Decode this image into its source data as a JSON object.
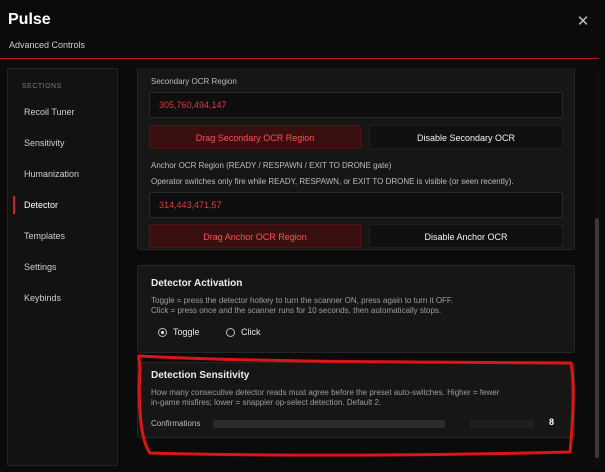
{
  "app": {
    "title": "Pulse",
    "subtitle": "Advanced Controls",
    "close_icon": "close-icon",
    "accent_color": "#c2161f"
  },
  "sidebar": {
    "section_label": "SECTIONS",
    "items": [
      {
        "label": "Recoil Tuner",
        "active": false
      },
      {
        "label": "Sensitivity",
        "active": false
      },
      {
        "label": "Humanization",
        "active": false
      },
      {
        "label": "Detector",
        "active": true
      },
      {
        "label": "Templates",
        "active": false
      },
      {
        "label": "Settings",
        "active": false
      },
      {
        "label": "Keybinds",
        "active": false
      }
    ]
  },
  "secondary_ocr": {
    "label": "Secondary OCR Region",
    "value": "305,760,494,147",
    "drag_label": "Drag Secondary OCR Region",
    "disable_label": "Disable Secondary OCR"
  },
  "anchor_ocr": {
    "label": "Anchor OCR Region (READY / RESPAWN / EXIT TO DRONE gate)",
    "description": "Operator switches only fire while READY, RESPAWN, or EXIT TO DRONE is visible (or seen recently).",
    "value": "314,443,471,57",
    "drag_label": "Drag Anchor OCR Region",
    "disable_label": "Disable Anchor OCR"
  },
  "activation": {
    "title": "Detector Activation",
    "desc_line1": "Toggle = press the detector hotkey to turn the scanner ON, press again to turn it OFF.",
    "desc_line2": "Click = press once and the scanner runs for 10 seconds, then automatically stops.",
    "options": [
      {
        "label": "Toggle",
        "selected": true
      },
      {
        "label": "Click",
        "selected": false
      }
    ]
  },
  "sensitivity": {
    "title": "Detection Sensitivity",
    "desc_line1": "How many consecutive detector reads must agree before the preset auto-switches. Higher = fewer",
    "desc_line2": "in-game misfires; lower = snappier op-select detection. Default 2.",
    "confirmations_label": "Confirmations",
    "confirmations_value": "8"
  }
}
